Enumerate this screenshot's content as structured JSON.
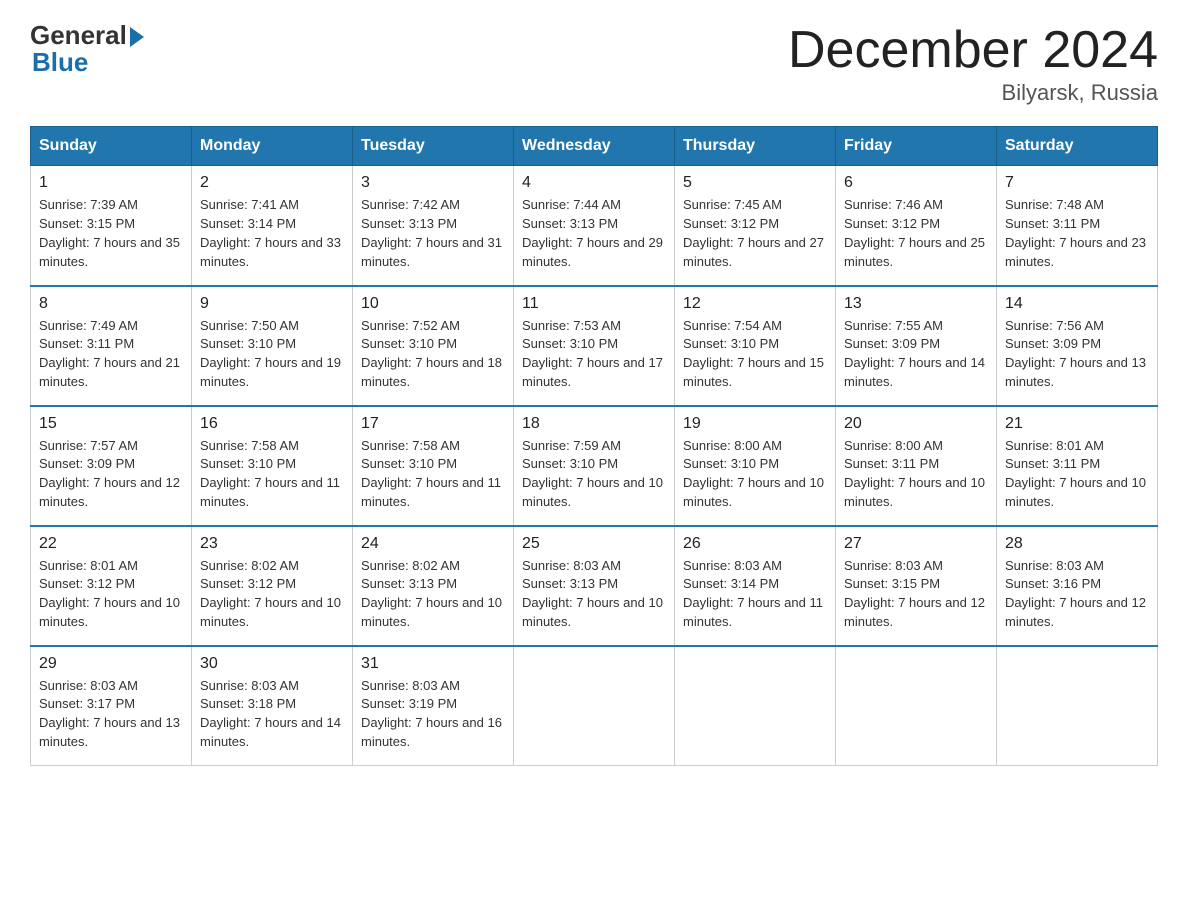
{
  "header": {
    "logo_general": "General",
    "logo_blue": "Blue",
    "month_title": "December 2024",
    "location": "Bilyarsk, Russia"
  },
  "days_of_week": [
    "Sunday",
    "Monday",
    "Tuesday",
    "Wednesday",
    "Thursday",
    "Friday",
    "Saturday"
  ],
  "weeks": [
    [
      {
        "day": "1",
        "sunrise": "7:39 AM",
        "sunset": "3:15 PM",
        "daylight": "7 hours and 35 minutes."
      },
      {
        "day": "2",
        "sunrise": "7:41 AM",
        "sunset": "3:14 PM",
        "daylight": "7 hours and 33 minutes."
      },
      {
        "day": "3",
        "sunrise": "7:42 AM",
        "sunset": "3:13 PM",
        "daylight": "7 hours and 31 minutes."
      },
      {
        "day": "4",
        "sunrise": "7:44 AM",
        "sunset": "3:13 PM",
        "daylight": "7 hours and 29 minutes."
      },
      {
        "day": "5",
        "sunrise": "7:45 AM",
        "sunset": "3:12 PM",
        "daylight": "7 hours and 27 minutes."
      },
      {
        "day": "6",
        "sunrise": "7:46 AM",
        "sunset": "3:12 PM",
        "daylight": "7 hours and 25 minutes."
      },
      {
        "day": "7",
        "sunrise": "7:48 AM",
        "sunset": "3:11 PM",
        "daylight": "7 hours and 23 minutes."
      }
    ],
    [
      {
        "day": "8",
        "sunrise": "7:49 AM",
        "sunset": "3:11 PM",
        "daylight": "7 hours and 21 minutes."
      },
      {
        "day": "9",
        "sunrise": "7:50 AM",
        "sunset": "3:10 PM",
        "daylight": "7 hours and 19 minutes."
      },
      {
        "day": "10",
        "sunrise": "7:52 AM",
        "sunset": "3:10 PM",
        "daylight": "7 hours and 18 minutes."
      },
      {
        "day": "11",
        "sunrise": "7:53 AM",
        "sunset": "3:10 PM",
        "daylight": "7 hours and 17 minutes."
      },
      {
        "day": "12",
        "sunrise": "7:54 AM",
        "sunset": "3:10 PM",
        "daylight": "7 hours and 15 minutes."
      },
      {
        "day": "13",
        "sunrise": "7:55 AM",
        "sunset": "3:09 PM",
        "daylight": "7 hours and 14 minutes."
      },
      {
        "day": "14",
        "sunrise": "7:56 AM",
        "sunset": "3:09 PM",
        "daylight": "7 hours and 13 minutes."
      }
    ],
    [
      {
        "day": "15",
        "sunrise": "7:57 AM",
        "sunset": "3:09 PM",
        "daylight": "7 hours and 12 minutes."
      },
      {
        "day": "16",
        "sunrise": "7:58 AM",
        "sunset": "3:10 PM",
        "daylight": "7 hours and 11 minutes."
      },
      {
        "day": "17",
        "sunrise": "7:58 AM",
        "sunset": "3:10 PM",
        "daylight": "7 hours and 11 minutes."
      },
      {
        "day": "18",
        "sunrise": "7:59 AM",
        "sunset": "3:10 PM",
        "daylight": "7 hours and 10 minutes."
      },
      {
        "day": "19",
        "sunrise": "8:00 AM",
        "sunset": "3:10 PM",
        "daylight": "7 hours and 10 minutes."
      },
      {
        "day": "20",
        "sunrise": "8:00 AM",
        "sunset": "3:11 PM",
        "daylight": "7 hours and 10 minutes."
      },
      {
        "day": "21",
        "sunrise": "8:01 AM",
        "sunset": "3:11 PM",
        "daylight": "7 hours and 10 minutes."
      }
    ],
    [
      {
        "day": "22",
        "sunrise": "8:01 AM",
        "sunset": "3:12 PM",
        "daylight": "7 hours and 10 minutes."
      },
      {
        "day": "23",
        "sunrise": "8:02 AM",
        "sunset": "3:12 PM",
        "daylight": "7 hours and 10 minutes."
      },
      {
        "day": "24",
        "sunrise": "8:02 AM",
        "sunset": "3:13 PM",
        "daylight": "7 hours and 10 minutes."
      },
      {
        "day": "25",
        "sunrise": "8:03 AM",
        "sunset": "3:13 PM",
        "daylight": "7 hours and 10 minutes."
      },
      {
        "day": "26",
        "sunrise": "8:03 AM",
        "sunset": "3:14 PM",
        "daylight": "7 hours and 11 minutes."
      },
      {
        "day": "27",
        "sunrise": "8:03 AM",
        "sunset": "3:15 PM",
        "daylight": "7 hours and 12 minutes."
      },
      {
        "day": "28",
        "sunrise": "8:03 AM",
        "sunset": "3:16 PM",
        "daylight": "7 hours and 12 minutes."
      }
    ],
    [
      {
        "day": "29",
        "sunrise": "8:03 AM",
        "sunset": "3:17 PM",
        "daylight": "7 hours and 13 minutes."
      },
      {
        "day": "30",
        "sunrise": "8:03 AM",
        "sunset": "3:18 PM",
        "daylight": "7 hours and 14 minutes."
      },
      {
        "day": "31",
        "sunrise": "8:03 AM",
        "sunset": "3:19 PM",
        "daylight": "7 hours and 16 minutes."
      },
      null,
      null,
      null,
      null
    ]
  ]
}
